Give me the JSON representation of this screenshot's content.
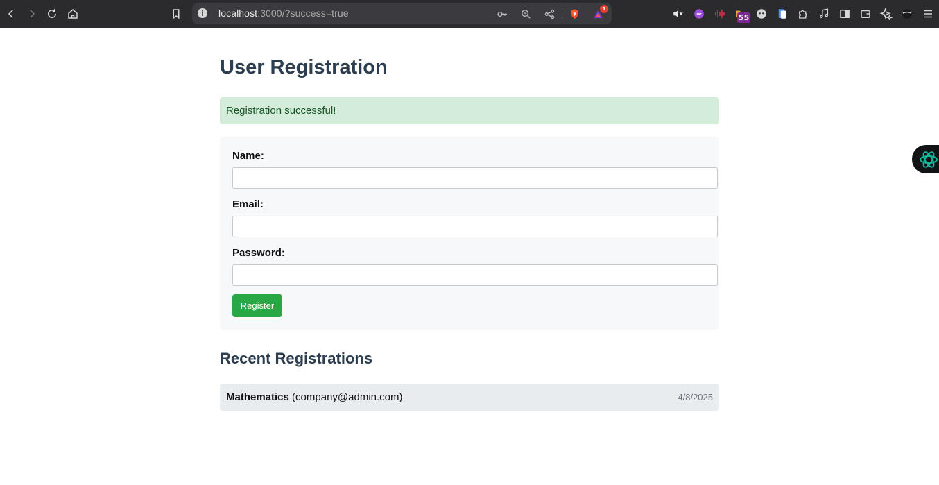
{
  "browser": {
    "url_host": "localhost",
    "url_rest": ":3000/?success=true",
    "notification_count": "1",
    "extension_badge": "55"
  },
  "page": {
    "title": "User Registration",
    "success_message": "Registration successful!",
    "form": {
      "name_label": "Name:",
      "name_value": "",
      "email_label": "Email:",
      "email_value": "",
      "password_label": "Password:",
      "password_value": "",
      "submit_label": "Register"
    },
    "recent": {
      "heading": "Recent Registrations",
      "items": [
        {
          "name": "Mathematics",
          "email": "(company@admin.com)",
          "date": "4/8/2025"
        }
      ]
    }
  },
  "colors": {
    "heading": "#2c3e50",
    "success_bg": "#d4edda",
    "success_text": "#155724",
    "button": "#28a745"
  }
}
